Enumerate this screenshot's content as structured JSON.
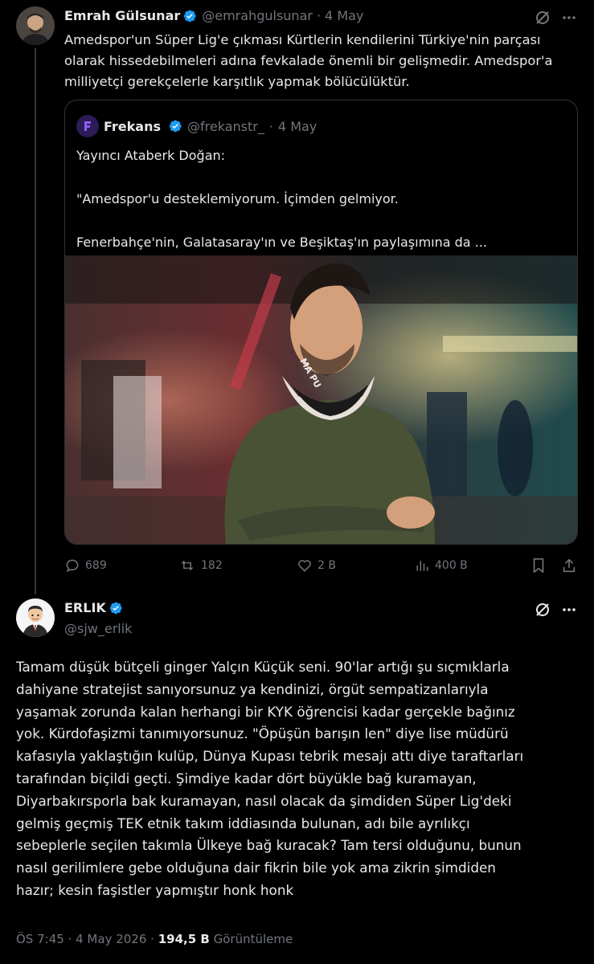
{
  "tweet1": {
    "author_name": "Emrah Gülsunar",
    "handle": "@emrahgulsunar",
    "separator": "·",
    "date": "4 May",
    "text": "Amedspor'un Süper Lig'e çıkması Kürtlerin kendilerini Türkiye'nin parçası\nolarak hissedebilmeleri adına fevkalade önemli bir gelişmedir. Amedspor'a\nmilliyetçi gerekçelerle karşıtlık yapmak bölücülüktür.",
    "quote": {
      "author_name": "Frekans",
      "handle": "@frekanstr_",
      "separator": "·",
      "date": "4 May",
      "line1": "Yayıncı Ataberk Doğan:",
      "line2": "\"Amedspor'u desteklemiyorum. İçimden gelmiyor.",
      "line3": "Fenerbahçe'nin, Galatasaray'ın ve Beşiktaş'ın paylaşımına da ...",
      "image_text": "MA PU"
    },
    "actions": {
      "replies": "689",
      "reposts": "182",
      "likes": "2 B",
      "views": "400 B"
    }
  },
  "tweet2": {
    "author_name": "ERLIK",
    "handle": "@sjw_erlik",
    "text": "Tamam düşük bütçeli ginger Yalçın Küçük seni. 90'lar artığı şu sıçmıklarla\ndahiyane stratejist sanıyorsunuz ya kendinizi, örgüt sempatizanlarıyla\nyaşamak zorunda kalan herhangi bir KYK öğrencisi kadar gerçekle bağınız\nyok. Kürdofaşizmi tanımıyorsunuz. \"Öpüşün barışın len\" diye lise müdürü\nkafasıyla yaklaştığın kulüp, Dünya Kupası tebrik mesajı attı diye taraftarları\ntarafından biçildi geçti. Şimdiye kadar dört büyükle bağ kuramayan,\nDiyarbakırsporla bak kuramayan, nasıl olacak da şimdiden Süper Lig'deki\ngelmiş geçmiş TEK etnik takım iddiasında bulunan, adı bile ayrılıkçı\nsebeplerle seçilen takımla Ülkeye bağ kuracak? Tam tersi olduğunu, bunun\nnasıl gerilimlere gebe olduğuna dair fikrin bile yok ama zikrin şimdiden\nhazır; kesin faşistler yapmıştır honk honk",
    "time": "ÖS 7:45",
    "separator": "·",
    "date": "4 May 2026",
    "separator2": "·",
    "views_count": "194,5 B",
    "views_label": "Görüntüleme"
  },
  "colors": {
    "background": "#000000",
    "text": "#e7e9ea",
    "secondary": "#71767b",
    "verified": "#1d9bf0",
    "border": "#2f3336"
  },
  "icons": [
    "grok-icon",
    "more-icon",
    "verified-icon",
    "reply-icon",
    "repost-icon",
    "like-icon",
    "views-icon",
    "bookmark-icon",
    "share-icon"
  ]
}
